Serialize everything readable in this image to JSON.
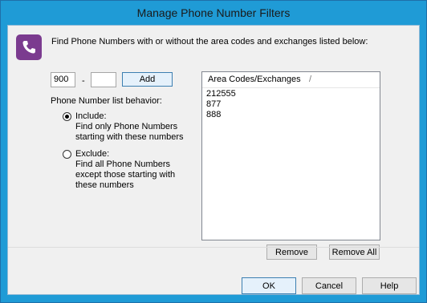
{
  "window": {
    "title": "Manage Phone Number Filters"
  },
  "intro": "Find Phone Numbers with or without the area codes and exchanges listed below:",
  "entry": {
    "area_value": "900",
    "separator": "-",
    "exchange_value": "",
    "add_label": "Add"
  },
  "behavior": {
    "label": "Phone Number list behavior:",
    "include": {
      "title": "Include:",
      "lines": [
        "Find only Phone Numbers",
        "starting with these numbers"
      ],
      "selected": true
    },
    "exclude": {
      "title": "Exclude:",
      "lines": [
        "Find all Phone Numbers",
        "except those starting with",
        "these numbers"
      ],
      "selected": false
    }
  },
  "list": {
    "header": "Area Codes/Exchanges",
    "sort_glyph": "/",
    "items": [
      "212555",
      "877",
      "888"
    ]
  },
  "list_buttons": {
    "remove_label": "Remove",
    "remove_all_label": "Remove All"
  },
  "footer_buttons": {
    "ok_label": "OK",
    "cancel_label": "Cancel",
    "help_label": "Help"
  },
  "colors": {
    "frame": "#1f9bd6",
    "icon_bg": "#7b3b8f",
    "client_bg": "#f0f0f0"
  },
  "icons": {
    "app": "phone-icon"
  }
}
